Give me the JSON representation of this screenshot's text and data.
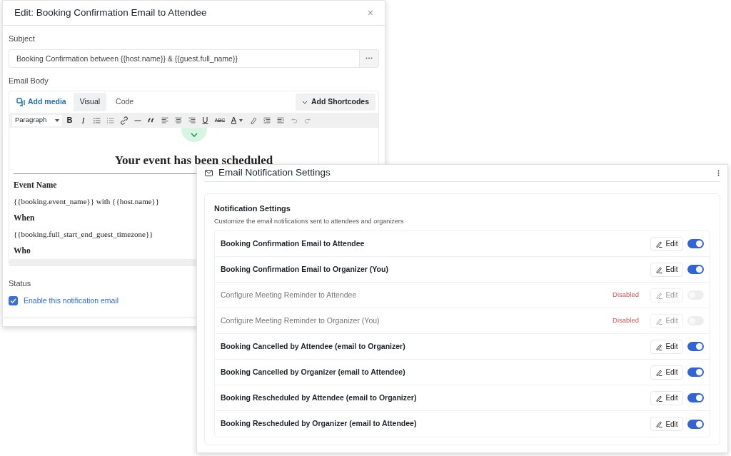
{
  "edit_dialog": {
    "title": "Edit: Booking Confirmation Email to Attendee",
    "close": "×",
    "subject": {
      "label": "Subject",
      "value": "Booking Confirmation between {{host.name}} & {{guest.full_name}}"
    },
    "email_body": {
      "label": "Email Body",
      "add_media": "Add media",
      "tabs": [
        {
          "label": "Visual",
          "selected": true
        },
        {
          "label": "Code",
          "selected": false
        }
      ],
      "add_shortcodes": "Add Shortcodes",
      "format": "Paragraph",
      "toolbar": [
        {
          "kind": "text",
          "text": "B"
        },
        {
          "kind": "text",
          "text": "I"
        },
        {
          "kind": "icon"
        },
        {
          "kind": "icon"
        },
        {
          "kind": "icon"
        },
        {
          "kind": "icon"
        },
        {
          "kind": "icon"
        },
        {
          "kind": "icon"
        },
        {
          "kind": "icon"
        },
        {
          "kind": "icon"
        },
        {
          "kind": "text",
          "text": "U"
        },
        {
          "kind": "text",
          "text": "ABC"
        },
        {
          "kind": "text",
          "text": "A"
        },
        {
          "kind": "icon"
        },
        {
          "kind": "icon"
        },
        {
          "kind": "icon"
        },
        {
          "kind": "icon"
        },
        {
          "kind": "icon"
        }
      ],
      "content": {
        "heading": "Your event has been scheduled",
        "blocks": [
          {
            "kind": "label",
            "text": "Event Name"
          },
          {
            "kind": "value",
            "text": "{{booking.event_name}} with {{host.name}}"
          },
          {
            "kind": "label",
            "text": "When"
          },
          {
            "kind": "value",
            "text": "{{booking.full_start_end_guest_timezone}}"
          },
          {
            "kind": "label",
            "text": "Who"
          }
        ]
      }
    },
    "status": {
      "label": "Status",
      "checkbox_label": "Enable this notification email",
      "checked": true
    }
  },
  "settings_panel": {
    "title": "Email Notification Settings",
    "section_title": "Notification Settings",
    "section_subtitle": "Customize the email notifications sent to attendees and organizers",
    "rows": [
      {
        "label": "Booking Confirmation Email to Attendee",
        "on": true,
        "edit": "Edit"
      },
      {
        "label": "Booking Confirmation Email to Organizer (You)",
        "on": true,
        "edit": "Edit"
      },
      {
        "label": "Configure Meeting Reminder to Attendee",
        "on": false,
        "status_text": "Disabled",
        "edit": "Edit"
      },
      {
        "label": "Configure Meeting Reminder to Organizer (You)",
        "on": false,
        "status_text": "Disabled",
        "edit": "Edit"
      },
      {
        "label": "Booking Cancelled by Attendee (email to Organizer)",
        "on": true,
        "edit": "Edit"
      },
      {
        "label": "Booking Cancelled by Organizer (email to Attendee)",
        "on": true,
        "edit": "Edit"
      },
      {
        "label": "Booking Rescheduled by Attendee (email to Organizer)",
        "on": true,
        "edit": "Edit"
      },
      {
        "label": "Booking Rescheduled by Organizer (email to Attendee)",
        "on": true,
        "edit": "Edit"
      }
    ]
  }
}
